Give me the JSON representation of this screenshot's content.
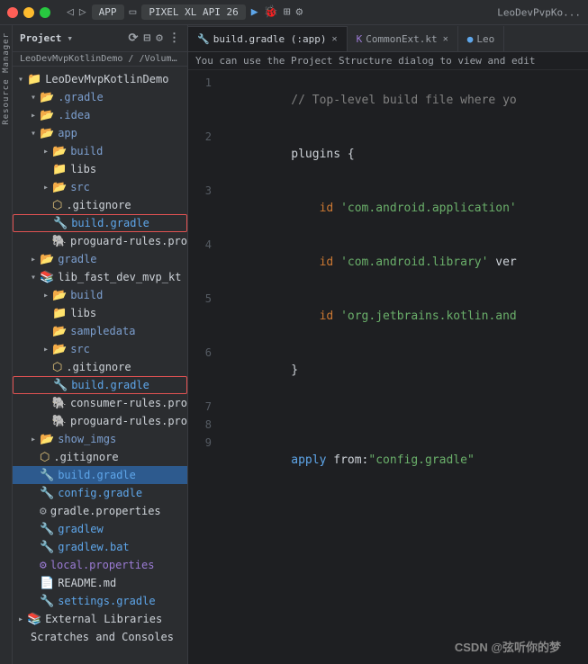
{
  "titleBar": {
    "appName": "LeoDevMvpKotlinDemo",
    "breadcrumb": "build.gradle",
    "toolbarItems": [
      "APP",
      "PIXEL XL API 26"
    ],
    "rightText": "LeoDevPvpKo..."
  },
  "projectPanel": {
    "header": "Project",
    "dropdownArrow": "▾",
    "breadcrumb": "LeoDevMvpKotlinDemo / /Volumes/Data/AndroidProjects/AndroidProject/Leo"
  },
  "fileTree": [
    {
      "id": "leodevmvp-root",
      "indent": 0,
      "arrow": "▾",
      "icon": "📁",
      "iconColor": "folder",
      "label": "LeoDevMvpKotlinDemo",
      "type": "folder"
    },
    {
      "id": "gradle-folder",
      "indent": 1,
      "arrow": "▾",
      "icon": "📂",
      "iconColor": "folder",
      "label": ".gradle",
      "type": "folder"
    },
    {
      "id": "idea-folder",
      "indent": 1,
      "arrow": "▸",
      "icon": "📂",
      "iconColor": "folder",
      "label": ".idea",
      "type": "folder"
    },
    {
      "id": "app-folder",
      "indent": 1,
      "arrow": "▾",
      "icon": "📂",
      "iconColor": "folder",
      "label": "app",
      "type": "folder"
    },
    {
      "id": "app-build",
      "indent": 2,
      "arrow": "▸",
      "icon": "📂",
      "iconColor": "folder",
      "label": "build",
      "type": "folder"
    },
    {
      "id": "app-libs",
      "indent": 2,
      "arrow": "",
      "icon": "📁",
      "iconColor": "folder",
      "label": "libs",
      "type": "folder"
    },
    {
      "id": "app-src",
      "indent": 2,
      "arrow": "▸",
      "icon": "📂",
      "iconColor": "folder",
      "label": "src",
      "type": "folder"
    },
    {
      "id": "app-gitignore",
      "indent": 2,
      "arrow": "",
      "icon": "⬡",
      "iconColor": "special",
      "label": ".gitignore",
      "type": "special"
    },
    {
      "id": "app-build-gradle",
      "indent": 2,
      "arrow": "",
      "icon": "🔧",
      "iconColor": "gradle",
      "label": "build.gradle",
      "type": "gradle",
      "outlined": true
    },
    {
      "id": "app-proguard",
      "indent": 2,
      "arrow": "",
      "icon": "🐘",
      "iconColor": "proguard",
      "label": "proguard-rules.pro",
      "type": "proguard"
    },
    {
      "id": "gradle-folder2",
      "indent": 1,
      "arrow": "▸",
      "icon": "📂",
      "iconColor": "folder",
      "label": "gradle",
      "type": "folder"
    },
    {
      "id": "lib-fast",
      "indent": 1,
      "arrow": "▾",
      "icon": "📚",
      "iconColor": "folder",
      "label": "lib_fast_dev_mvp_kt",
      "type": "module"
    },
    {
      "id": "lib-build",
      "indent": 2,
      "arrow": "▸",
      "icon": "📂",
      "iconColor": "folder",
      "label": "build",
      "type": "folder"
    },
    {
      "id": "lib-libs",
      "indent": 2,
      "arrow": "",
      "icon": "📁",
      "iconColor": "folder",
      "label": "libs",
      "type": "folder"
    },
    {
      "id": "lib-sampledata",
      "indent": 2,
      "arrow": "",
      "icon": "📂",
      "iconColor": "folder",
      "label": "sampledata",
      "type": "folder"
    },
    {
      "id": "lib-src",
      "indent": 2,
      "arrow": "▸",
      "icon": "📂",
      "iconColor": "folder",
      "label": "src",
      "type": "folder"
    },
    {
      "id": "lib-gitignore",
      "indent": 2,
      "arrow": "",
      "icon": "⬡",
      "iconColor": "special",
      "label": ".gitignore",
      "type": "special"
    },
    {
      "id": "lib-build-gradle",
      "indent": 2,
      "arrow": "",
      "icon": "🔧",
      "iconColor": "gradle",
      "label": "build.gradle",
      "type": "gradle",
      "outlined": true
    },
    {
      "id": "lib-consumer",
      "indent": 2,
      "arrow": "",
      "icon": "🐘",
      "iconColor": "proguard",
      "label": "consumer-rules.pro",
      "type": "proguard"
    },
    {
      "id": "lib-proguard",
      "indent": 2,
      "arrow": "",
      "icon": "🐘",
      "iconColor": "proguard",
      "label": "proguard-rules.pro",
      "type": "proguard"
    },
    {
      "id": "show-imgs",
      "indent": 1,
      "arrow": "▸",
      "icon": "📂",
      "iconColor": "folder",
      "label": "show_imgs",
      "type": "folder"
    },
    {
      "id": "root-gitignore",
      "indent": 1,
      "arrow": "",
      "icon": "⬡",
      "iconColor": "special",
      "label": ".gitignore",
      "type": "special"
    },
    {
      "id": "root-build-gradle",
      "indent": 1,
      "arrow": "",
      "icon": "🔧",
      "iconColor": "gradle",
      "label": "build.gradle",
      "type": "gradle",
      "selected": true
    },
    {
      "id": "root-config-gradle",
      "indent": 1,
      "arrow": "",
      "icon": "🔧",
      "iconColor": "gradle",
      "label": "config.gradle",
      "type": "gradle"
    },
    {
      "id": "gradle-props",
      "indent": 1,
      "arrow": "",
      "icon": "⚙️",
      "iconColor": "props",
      "label": "gradle.properties",
      "type": "props"
    },
    {
      "id": "gradlew",
      "indent": 1,
      "arrow": "",
      "icon": "🔧",
      "iconColor": "gradle",
      "label": "gradlew",
      "type": "gradle"
    },
    {
      "id": "gradlew-bat",
      "indent": 1,
      "arrow": "",
      "icon": "🔧",
      "iconColor": "gradle",
      "label": "gradlew.bat",
      "type": "gradle"
    },
    {
      "id": "local-props",
      "indent": 1,
      "arrow": "",
      "icon": "⚙️",
      "iconColor": "local",
      "label": "local.properties",
      "type": "local"
    },
    {
      "id": "readme",
      "indent": 1,
      "arrow": "",
      "icon": "📄",
      "iconColor": "readme",
      "label": "README.md",
      "type": "readme"
    },
    {
      "id": "settings-gradle",
      "indent": 1,
      "arrow": "",
      "icon": "🔧",
      "iconColor": "gradle",
      "label": "settings.gradle",
      "type": "gradle"
    },
    {
      "id": "external-libs",
      "indent": 0,
      "arrow": "▸",
      "icon": "📚",
      "iconColor": "folder",
      "label": "External Libraries",
      "type": "folder"
    },
    {
      "id": "scratches",
      "indent": 0,
      "arrow": "",
      "icon": "",
      "iconColor": "",
      "label": "Scratches and Consoles",
      "type": "scratch"
    }
  ],
  "tabs": [
    {
      "id": "tab-build-gradle",
      "label": "build.gradle (:app)",
      "icon": "gradle",
      "active": true,
      "closable": true
    },
    {
      "id": "tab-commonext",
      "label": "CommonExt.kt",
      "icon": "kotlin",
      "active": false,
      "closable": true
    },
    {
      "id": "tab-leo",
      "label": "Leo",
      "icon": "gradle",
      "active": false,
      "closable": false
    }
  ],
  "infoBar": {
    "text": "You can use the Project Structure dialog to view and edit"
  },
  "codeLines": [
    {
      "num": "1",
      "content": "  // Top-level build file where yo",
      "type": "comment"
    },
    {
      "num": "2",
      "content": "  plugins {",
      "type": "normal"
    },
    {
      "num": "3",
      "content": "      id 'com.android.application'",
      "type": "plugin"
    },
    {
      "num": "4",
      "content": "      id 'com.android.library' ver",
      "type": "plugin"
    },
    {
      "num": "5",
      "content": "      id 'org.jetbrains.kotlin.and",
      "type": "plugin"
    },
    {
      "num": "6",
      "content": "  }",
      "type": "normal"
    },
    {
      "num": "7",
      "content": "",
      "type": "empty"
    },
    {
      "num": "8",
      "content": "",
      "type": "empty"
    },
    {
      "num": "9",
      "content": "  apply from:\"config.gradle\"",
      "type": "apply"
    }
  ],
  "watermark": "CSDN @弦听你的梦",
  "stripLabels": [
    "Resource Manager"
  ]
}
